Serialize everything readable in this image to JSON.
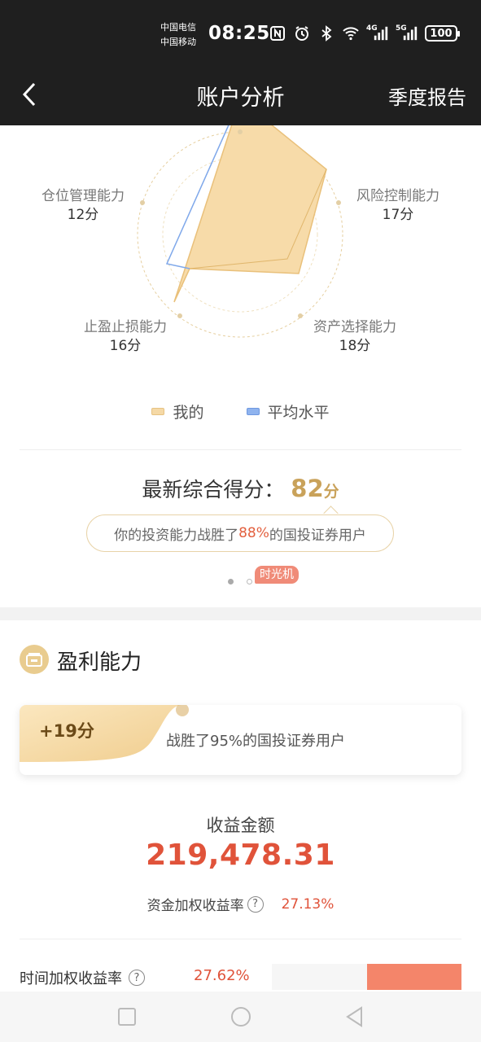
{
  "status_bar": {
    "carrier1": "中国电信",
    "carrier2": "中国移动",
    "time": "08:25",
    "net1": "4G",
    "net2": "5G",
    "battery": "100"
  },
  "header": {
    "title": "账户分析",
    "report_label": "季度报告"
  },
  "radar": {
    "dimensions": [
      {
        "label": "风险控制能力",
        "score": "17分"
      },
      {
        "label": "资产选择能力",
        "score": "18分"
      },
      {
        "label": "止盈止损能力",
        "score": "16分"
      },
      {
        "label": "仓位管理能力",
        "score": "12分"
      }
    ],
    "legend": [
      {
        "name": "我的",
        "color": "#f5d9a6"
      },
      {
        "name": "平均水平",
        "color": "#8fb3ee"
      }
    ]
  },
  "summary": {
    "label": "最新综合得分：",
    "score": "82",
    "unit": "分",
    "beat_prefix": "你的投资能力战胜了",
    "beat_pct": "88%",
    "beat_suffix": "的国投证券用户",
    "time_machine": "时光机"
  },
  "profit": {
    "title": "盈利能力",
    "bonus": "+19分",
    "beat_text": "战胜了95%的国投证券用户",
    "amount_label": "收益金额",
    "amount": "219,478.31",
    "fund_weighted_label": "资金加权收益率",
    "fund_weighted_value": "27.13%",
    "time_weighted_label": "时间加权收益率",
    "time_weighted_value": "27.62%",
    "time_weighted_share": 0.5
  },
  "colors": {
    "accent_gold": "#c9a25a",
    "accent_red": "#e0533a"
  }
}
